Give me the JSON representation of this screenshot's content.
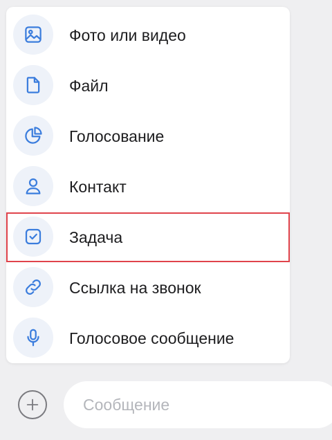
{
  "attachment_menu": {
    "items": [
      {
        "label": "Фото или видео",
        "icon": "image-icon"
      },
      {
        "label": "Файл",
        "icon": "file-icon"
      },
      {
        "label": "Голосование",
        "icon": "poll-pie-icon"
      },
      {
        "label": "Контакт",
        "icon": "contact-person-icon"
      },
      {
        "label": "Задача",
        "icon": "task-checkbox-icon",
        "highlighted": true
      },
      {
        "label": "Ссылка на звонок",
        "icon": "link-icon"
      },
      {
        "label": "Голосовое сообщение",
        "icon": "microphone-icon"
      }
    ]
  },
  "composer": {
    "attach_icon": "plus-circle-icon",
    "placeholder": "Сообщение"
  },
  "colors": {
    "accent": "#3b7ddd",
    "icon_background": "#eef2f9",
    "highlight_border": "#e0434b",
    "page_background": "#efeff1"
  }
}
